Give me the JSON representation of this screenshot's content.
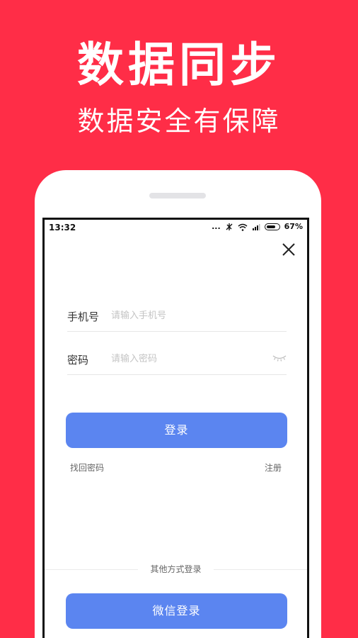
{
  "banner": {
    "headline": "数据同步",
    "subline": "数据安全有保障"
  },
  "status_bar": {
    "time": "13:32",
    "dots": "...",
    "battery": "67%"
  },
  "login": {
    "phone_label": "手机号",
    "phone_placeholder": "请输入手机号",
    "password_label": "密码",
    "password_placeholder": "请输入密码",
    "login_button": "登录",
    "forgot_password": "找回密码",
    "register": "注册",
    "other_methods": "其他方式登录",
    "wechat_button": "微信登录"
  },
  "colors": {
    "background": "#ff2d47",
    "button": "#5b85f0"
  }
}
